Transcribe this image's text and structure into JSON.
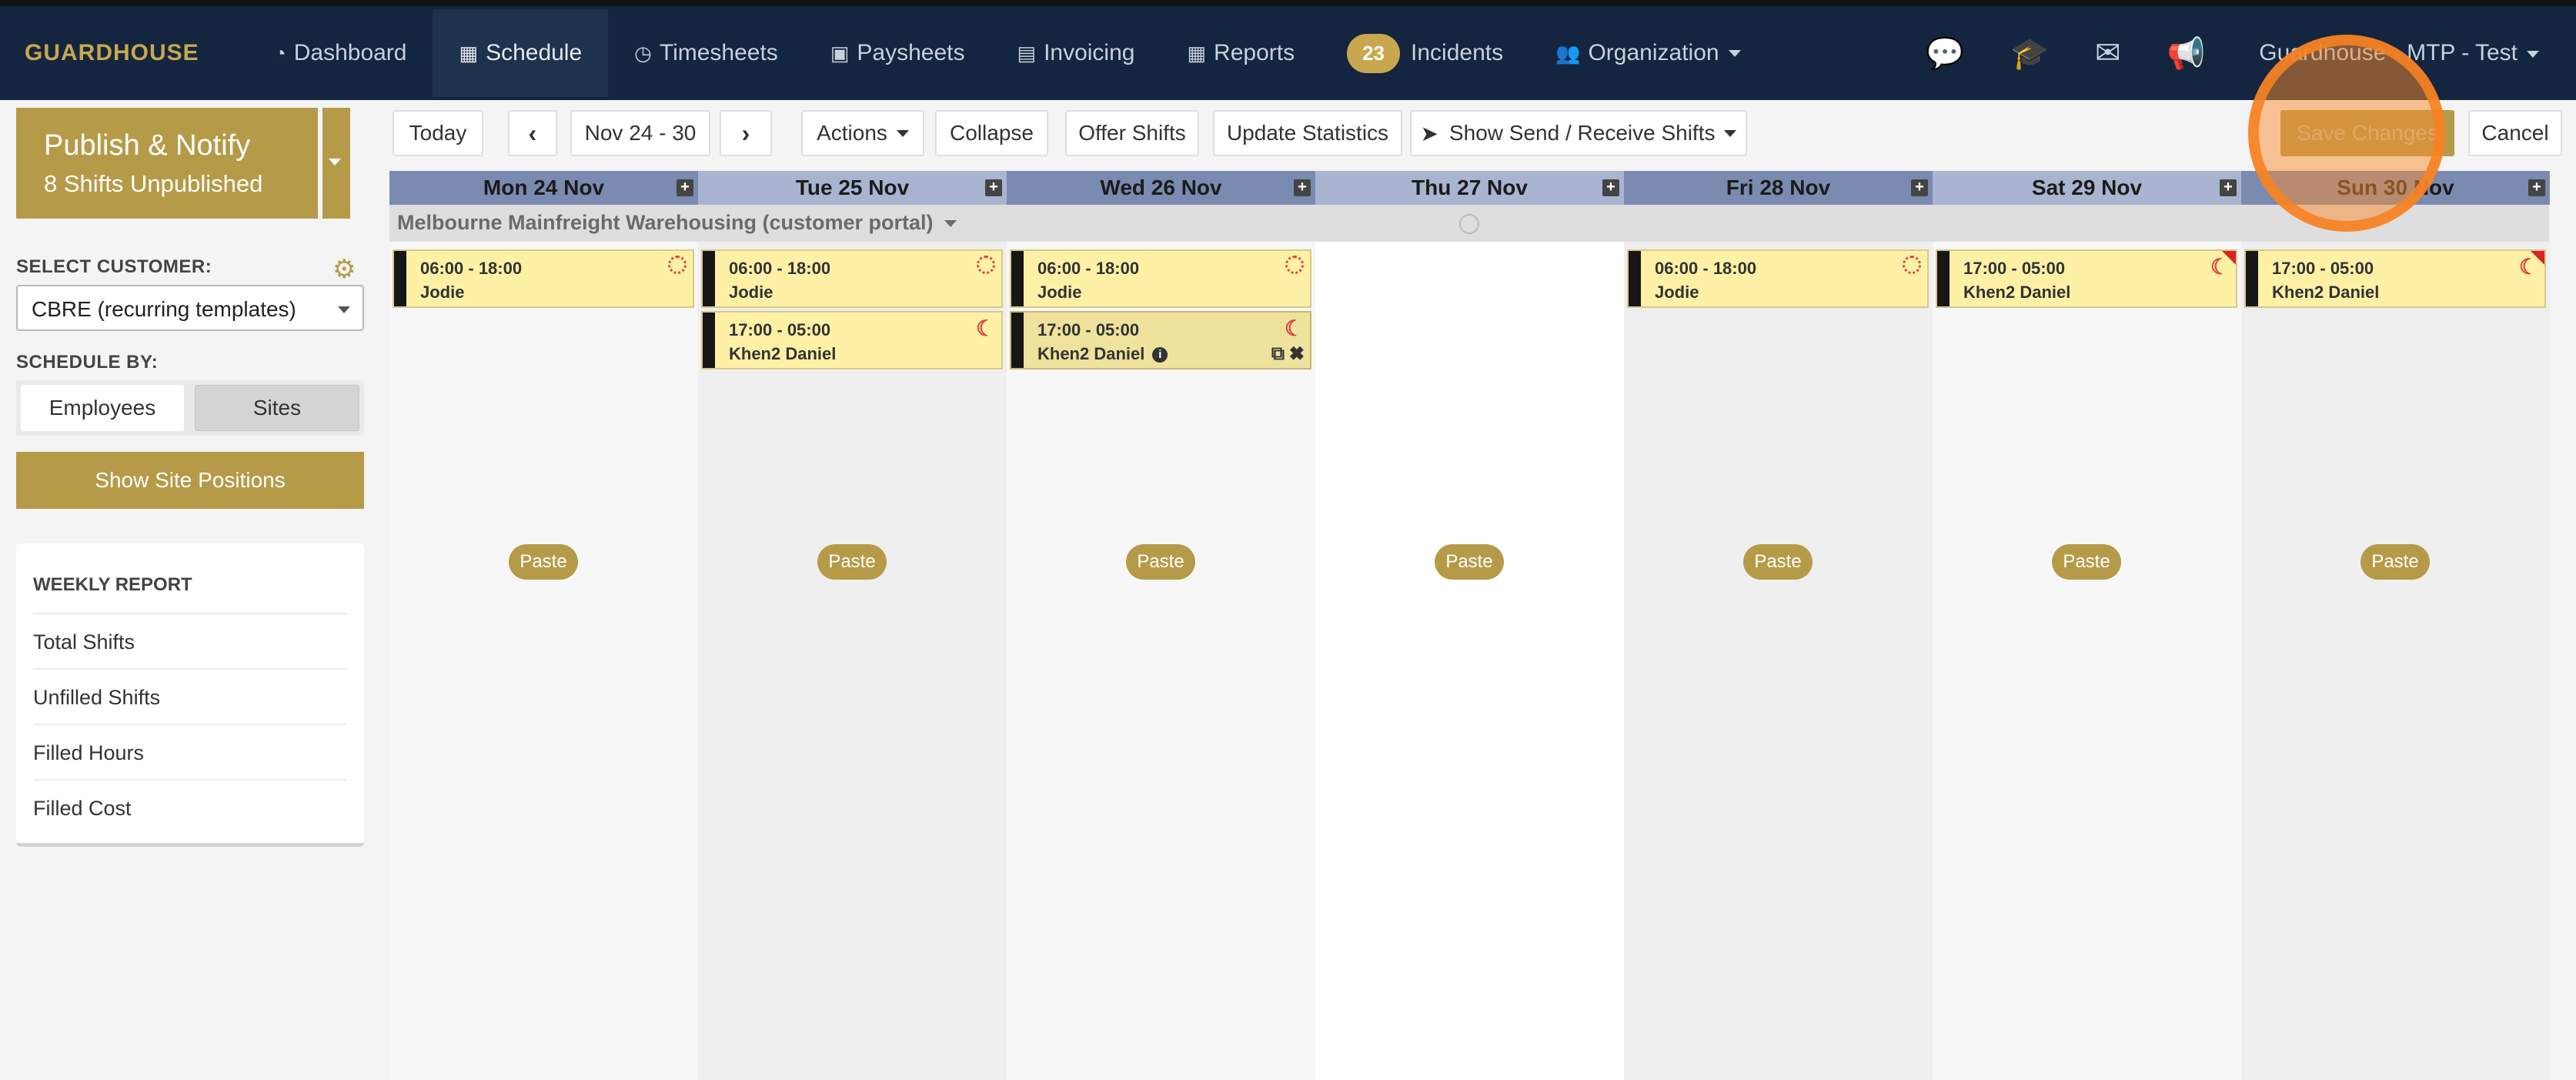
{
  "brand": "GUARDHOUSE",
  "nav": {
    "dashboard": "Dashboard",
    "schedule": "Schedule",
    "timesheets": "Timesheets",
    "paysheets": "Paysheets",
    "invoicing": "Invoicing",
    "reports": "Reports",
    "incidents_count": "23",
    "incidents": "Incidents",
    "organization": "Organization",
    "user": "Guardhouse - MTP - Test"
  },
  "sidebar": {
    "publish_title": "Publish & Notify",
    "publish_sub": "8 Shifts Unpublished",
    "select_customer_label": "SELECT CUSTOMER:",
    "customer_value": "CBRE (recurring templates)",
    "schedule_by_label": "SCHEDULE BY:",
    "schedule_by": [
      "Employees",
      "Sites"
    ],
    "show_site_positions": "Show Site Positions",
    "weekly_report_title": "WEEKLY REPORT",
    "weekly_report_items": [
      "Total Shifts",
      "Unfilled Shifts",
      "Filled Hours",
      "Filled Cost"
    ]
  },
  "toolbar": {
    "today": "Today",
    "range": "Nov 24 - 30",
    "actions": "Actions",
    "collapse": "Collapse",
    "offer_shifts": "Offer Shifts",
    "update_statistics": "Update Statistics",
    "send_receive": "Show Send / Receive Shifts",
    "save_changes": "Save Changes",
    "cancel": "Cancel"
  },
  "schedule": {
    "days": [
      "Mon 24 Nov",
      "Tue 25 Nov",
      "Wed 26 Nov",
      "Thu 27 Nov",
      "Fri 28 Nov",
      "Sat 29 Nov",
      "Sun 30 Nov"
    ],
    "site": "Melbourne Mainfreight Warehousing (customer portal)",
    "paste_label": "Paste",
    "shifts": {
      "mon_1": {
        "time": "06:00 - 18:00",
        "name": "Jodie"
      },
      "tue_1": {
        "time": "06:00 - 18:00",
        "name": "Jodie"
      },
      "tue_2": {
        "time": "17:00 - 05:00",
        "name": "Khen2 Daniel"
      },
      "wed_1": {
        "time": "06:00 - 18:00",
        "name": "Jodie"
      },
      "wed_2": {
        "time": "17:00 - 05:00",
        "name": "Khen2 Daniel"
      },
      "fri_1": {
        "time": "06:00 - 18:00",
        "name": "Jodie"
      },
      "sat_1": {
        "time": "17:00 - 05:00",
        "name": "Khen2 Daniel"
      },
      "sun_1": {
        "time": "17:00 - 05:00",
        "name": "Khen2 Daniel"
      }
    }
  },
  "colors": {
    "navbar": "#13253f",
    "accent_gold": "#b59a48",
    "shift_bg": "#fef1a6",
    "highlight": "#f78224"
  }
}
